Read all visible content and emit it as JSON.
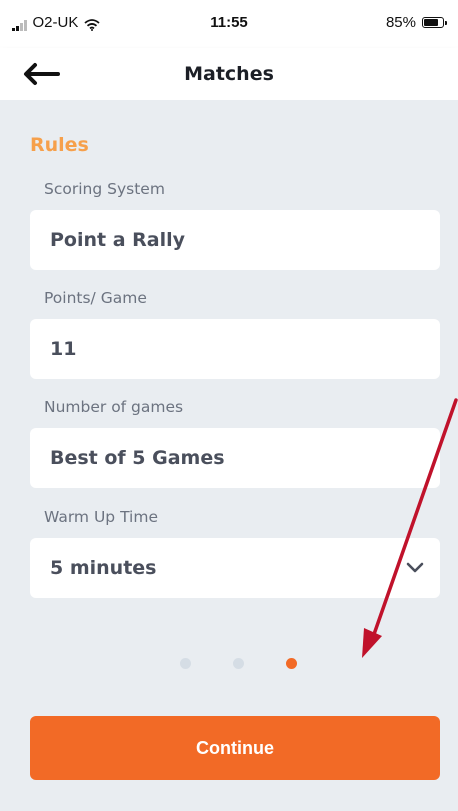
{
  "status_bar": {
    "carrier": "O2-UK",
    "time": "11:55",
    "battery": "85%",
    "battery_level": 0.85
  },
  "nav": {
    "title": "Matches",
    "back_icon": "arrow-left-icon"
  },
  "rules": {
    "title": "Rules",
    "fields": [
      {
        "label": "Scoring System",
        "value": "Point a Rally"
      },
      {
        "label": "Points/ Game",
        "value": "11"
      },
      {
        "label": "Number of games",
        "value": "Best of 5 Games"
      },
      {
        "label": "Warm Up Time",
        "value": "5 minutes",
        "icon": "chevron-down-icon"
      }
    ]
  },
  "pagination": {
    "total": 3,
    "active_index": 2
  },
  "continue_label": "Continue",
  "colors": {
    "accent": "#f26a26",
    "section_title": "#f6a04b",
    "annotation_arrow": "#c0122b",
    "dot_inactive": "#d5dde5"
  }
}
